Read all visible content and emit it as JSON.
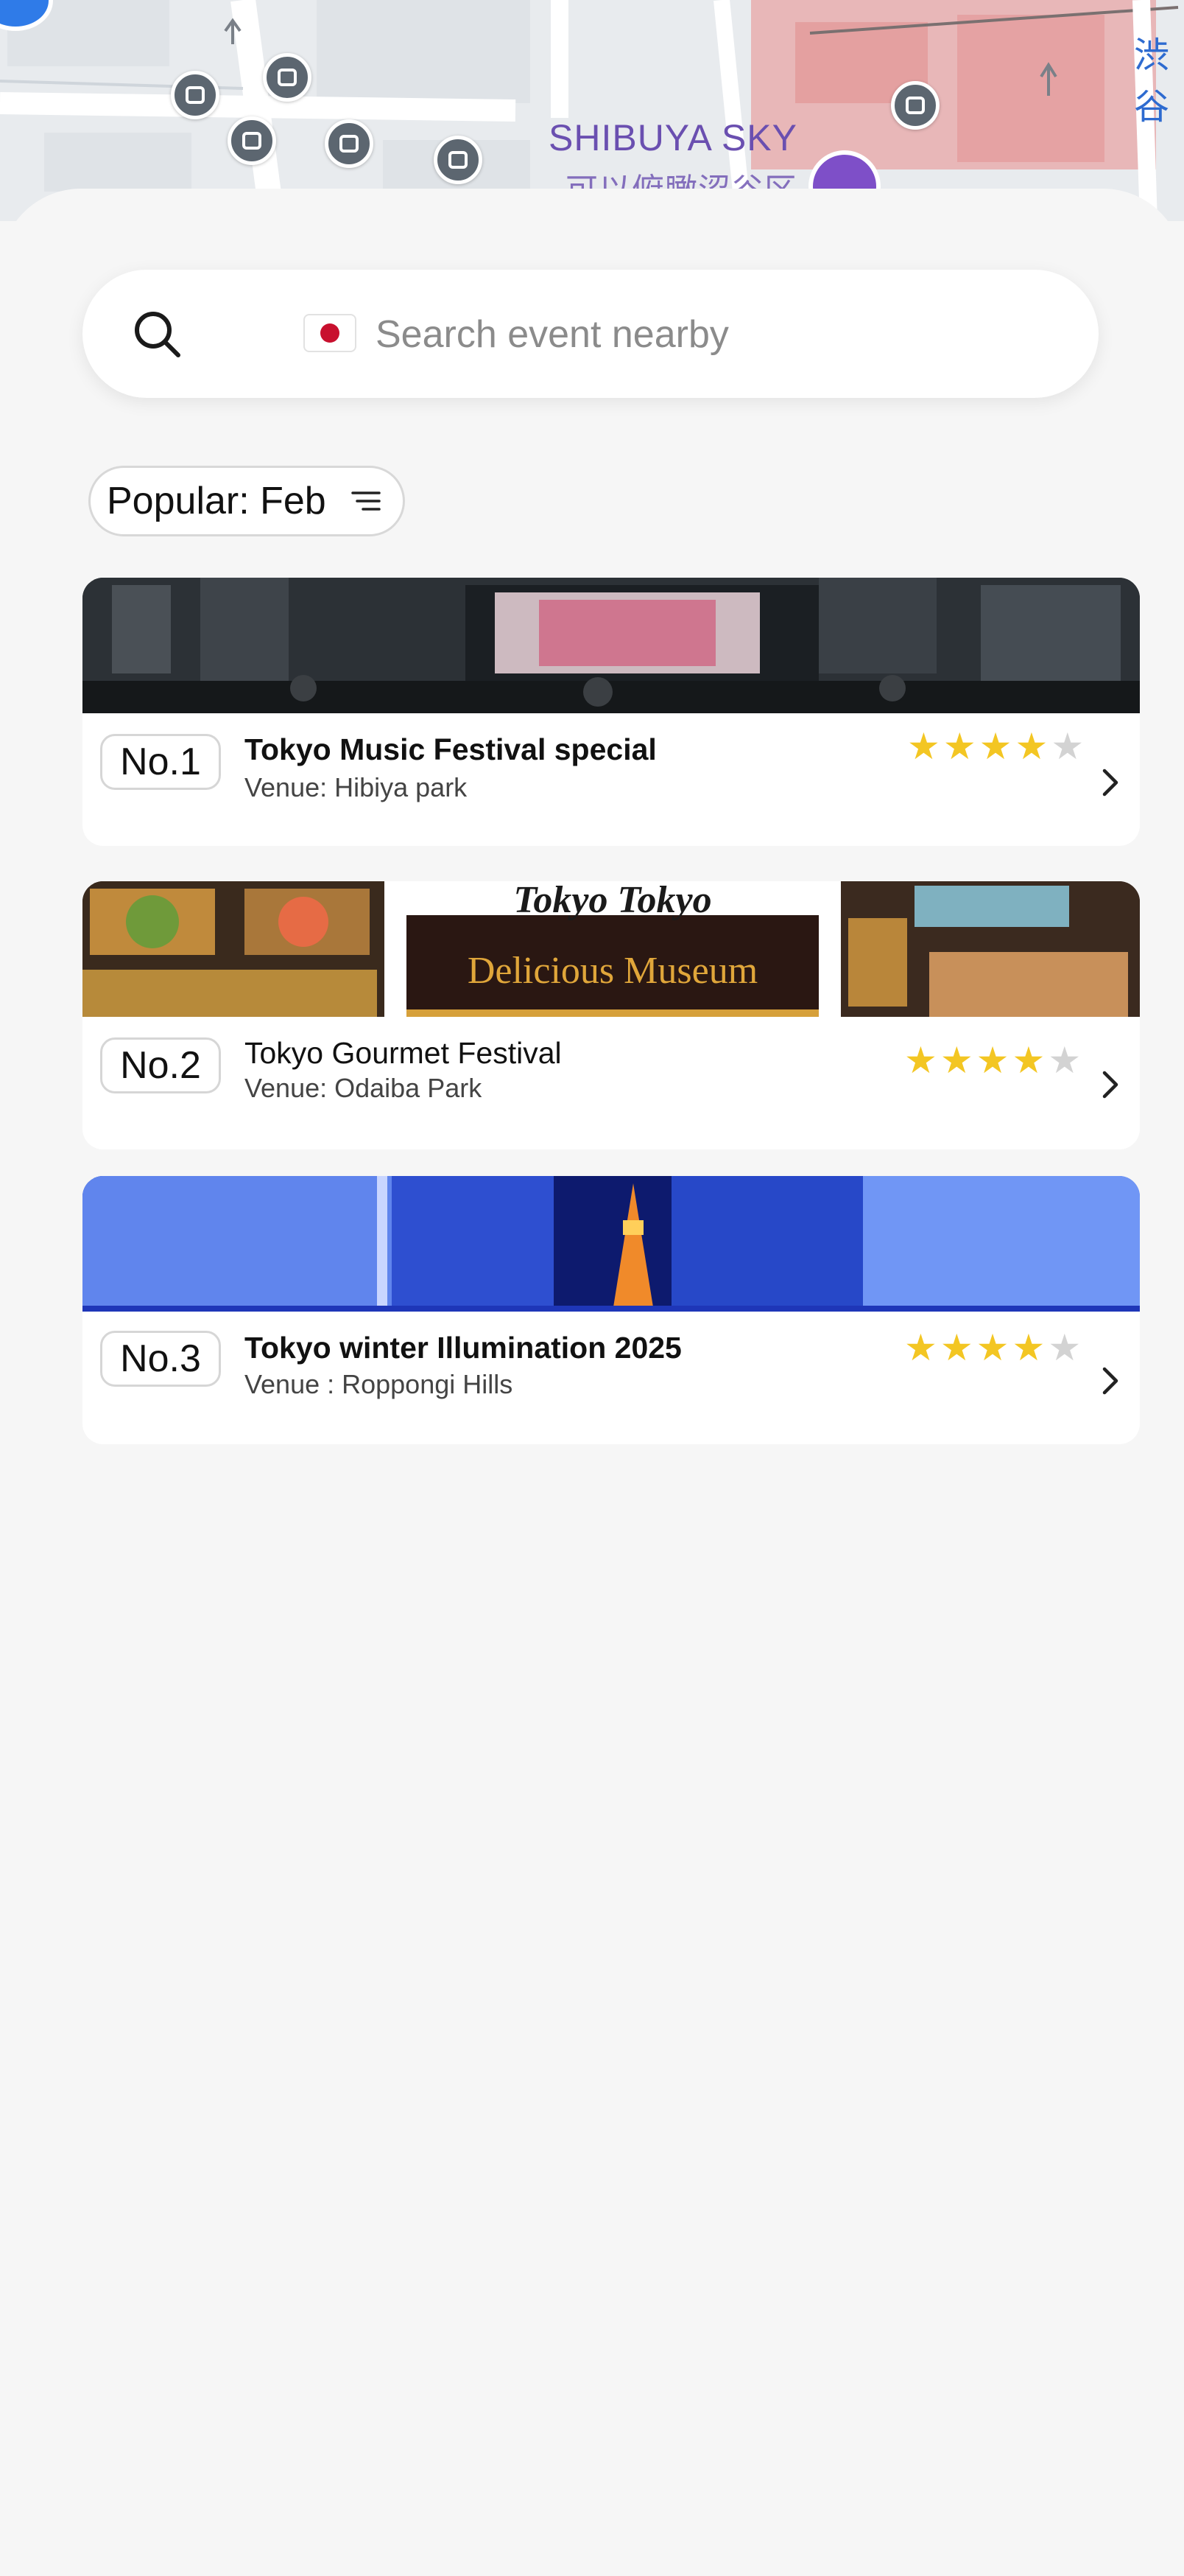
{
  "map": {
    "landmark_en": "SHIBUYA SKY",
    "landmark_jp": "可以俯瞰涩谷区",
    "corner_label": "渋谷"
  },
  "search": {
    "placeholder": "Search event nearby",
    "flag": "japan-flag"
  },
  "filter": {
    "label": "Popular: Feb"
  },
  "events": [
    {
      "rank": "No.1",
      "title": "Tokyo Music Festival special",
      "venue": "Venue: Hibiya park",
      "rating": 4,
      "max_rating": 5
    },
    {
      "rank": "No.2",
      "title": "Tokyo Gourmet Festival",
      "venue": "Venue: Odaiba Park",
      "rating": 4,
      "max_rating": 5,
      "banner_text": {
        "line1": "Tokyo Tokyo",
        "line2": "Delicious Museum"
      }
    },
    {
      "rank": "No.3",
      "title": "Tokyo winter Illumination 2025",
      "venue": "Venue : Roppongi Hills",
      "rating": 4,
      "max_rating": 5
    }
  ],
  "colors": {
    "star": "#f3c623",
    "star_empty": "#d3d3d3",
    "background": "#f6f6f6",
    "map_label": "#6a4fb0"
  }
}
